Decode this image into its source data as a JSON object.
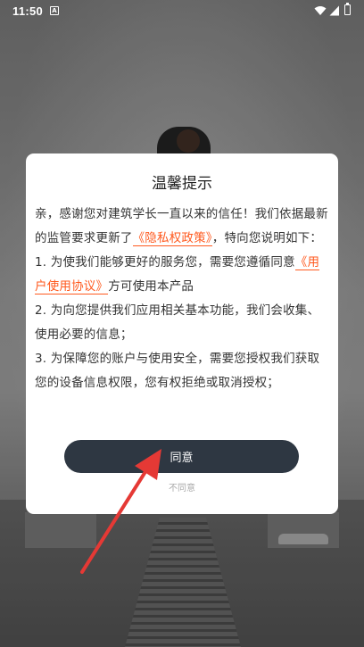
{
  "status_bar": {
    "time": "11:50",
    "notification_icon": "A",
    "wifi_icon": "wifi-icon",
    "signal_icon": "signal-icon",
    "battery_icon": "battery-icon"
  },
  "dialog": {
    "title": "温馨提示",
    "intro_1": "亲，感谢您对建筑学长一直以来的信任！我们依据最新的监管要求更新了",
    "privacy_link": "《隐私权政策》",
    "intro_2": "，特向您说明如下：",
    "item1_1": "1. 为使我们能够更好的服务您，需要您遵循同意",
    "user_agreement_link": "《用户使用协议》",
    "item1_2": "方可使用本产品",
    "item2": "2. 为向您提供我们应用相关基本功能，我们会收集、使用必要的信息；",
    "item3": "3. 为保障您的账户与使用安全，需要您授权我们获取您的设备信息权限，您有权拒绝或取消授权；",
    "agree_label": "同意",
    "disagree_label": "不同意"
  },
  "colors": {
    "link": "#ff5a1f",
    "button_bg": "#2e3742",
    "annotation_arrow": "#e53935"
  }
}
